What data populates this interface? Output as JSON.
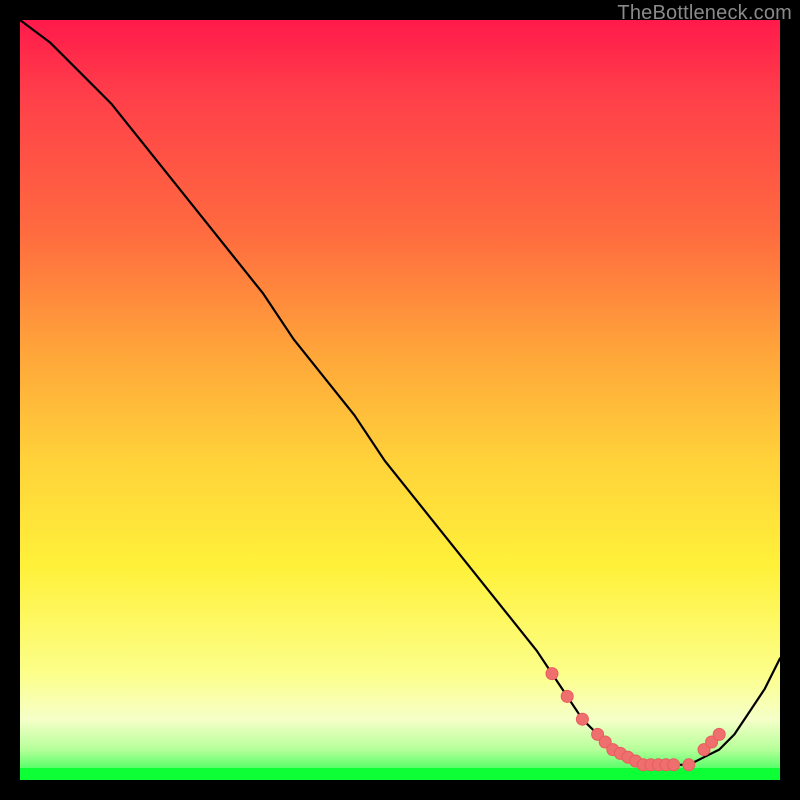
{
  "watermark": "TheBottleneck.com",
  "colors": {
    "curve_stroke": "#000000",
    "marker_fill": "#ef6f6f",
    "marker_stroke": "#e85c5c"
  },
  "chart_data": {
    "type": "line",
    "title": "",
    "xlabel": "",
    "ylabel": "",
    "xlim": [
      0,
      100
    ],
    "ylim": [
      0,
      100
    ],
    "series": [
      {
        "name": "bottleneck-curve",
        "x": [
          0,
          4,
          8,
          12,
          16,
          20,
          24,
          28,
          32,
          36,
          40,
          44,
          48,
          52,
          56,
          60,
          64,
          68,
          70,
          72,
          74,
          76,
          78,
          80,
          82,
          84,
          86,
          88,
          90,
          92,
          94,
          96,
          98,
          100
        ],
        "values": [
          100,
          97,
          93,
          89,
          84,
          79,
          74,
          69,
          64,
          58,
          53,
          48,
          42,
          37,
          32,
          27,
          22,
          17,
          14,
          11,
          8,
          6,
          4,
          3,
          2,
          2,
          2,
          2,
          3,
          4,
          6,
          9,
          12,
          16
        ]
      }
    ],
    "markers": {
      "x": [
        70,
        72,
        74,
        76,
        77,
        78,
        79,
        80,
        81,
        82,
        83,
        84,
        85,
        86,
        88,
        90,
        91,
        92
      ],
      "values": [
        14,
        11,
        8,
        6,
        5,
        4,
        3.5,
        3,
        2.5,
        2,
        2,
        2,
        2,
        2,
        2,
        4,
        5,
        6
      ]
    }
  }
}
